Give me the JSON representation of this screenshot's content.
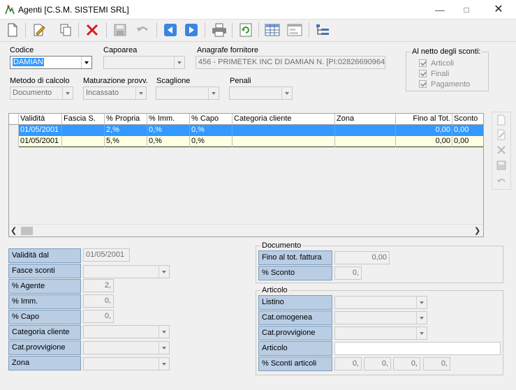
{
  "window": {
    "title": "Agenti [C.S.M. SISTEMI SRL]"
  },
  "toolbar": {
    "icons": [
      "new-icon",
      "edit-icon",
      "copy-icon",
      "delete-icon",
      "save-icon",
      "undo-icon",
      "prev-icon",
      "next-icon",
      "print-icon",
      "refresh-icon",
      "table-icon",
      "form-icon",
      "tree-icon"
    ]
  },
  "header": {
    "codice_label": "Codice",
    "codice_value": "DAMIAN",
    "capoarea_label": "Capoarea",
    "capoarea_value": "",
    "anagrafe_label": "Anagrafe fornitore",
    "anagrafe_value": "456 - PRIMETEK INC DI DAMIAN N. [PI:02826690964]",
    "metodo_label": "Metodo di calcolo",
    "metodo_value": "Documento",
    "maturazione_label": "Maturazione provv.",
    "maturazione_value": "Incassato",
    "scaglione_label": "Scaglione",
    "scaglione_value": "",
    "penali_label": "Penali",
    "penali_value": "",
    "netto_title": "Al netto degli sconti:",
    "netto_items": [
      "Articoli",
      "Finali",
      "Pagamento"
    ]
  },
  "grid": {
    "columns": [
      "Validità",
      "Fascia S.",
      "% Propria",
      "% Imm.",
      "% Capo",
      "Categoria cliente",
      "Zona",
      "Fino al Tot.",
      "Sconto"
    ],
    "rows": [
      [
        "01/05/2001",
        "",
        "2,%",
        "0,%",
        "0,%",
        "",
        "",
        "0,00",
        "0,00"
      ],
      [
        "01/05/2001",
        "",
        "5,%",
        "0,%",
        "0,%",
        "",
        "",
        "0,00",
        "0,00"
      ]
    ]
  },
  "detail": {
    "validita_label": "Validità dal",
    "validita_value": "01/05/2001",
    "fasce_label": "Fasce sconti",
    "fasce_value": "",
    "agente_label": "% Agente",
    "agente_value": "2,",
    "imm_label": "% Imm.",
    "imm_value": "0,",
    "capo_label": "% Capo",
    "capo_value": "0,",
    "catcli_label": "Categoria cliente",
    "catcli_value": "",
    "catprov_label": "Cat.provvigione",
    "catprov_value": "",
    "zona_label": "Zona",
    "zona_value": ""
  },
  "documento": {
    "title": "Documento",
    "fino_label": "Fino al tot. fattura",
    "fino_value": "0,00",
    "sconto_label": "% Sconto",
    "sconto_value": "0,"
  },
  "articolo": {
    "title": "Articolo",
    "listino_label": "Listino",
    "listino_value": "",
    "catomo_label": "Cat.omogenea",
    "catomo_value": "",
    "catprov_label": "Cat.provvigione",
    "catprov_value": "",
    "articolo_label": "Articolo",
    "articolo_value": "",
    "sconti_label": "% Sconti articoli",
    "sconti_values": [
      "0,",
      "0,",
      "0,",
      "0,"
    ]
  },
  "colors": {
    "selection": "#3399ff",
    "row_alt": "#ffffe1",
    "label_bg": "#b9cde5"
  }
}
